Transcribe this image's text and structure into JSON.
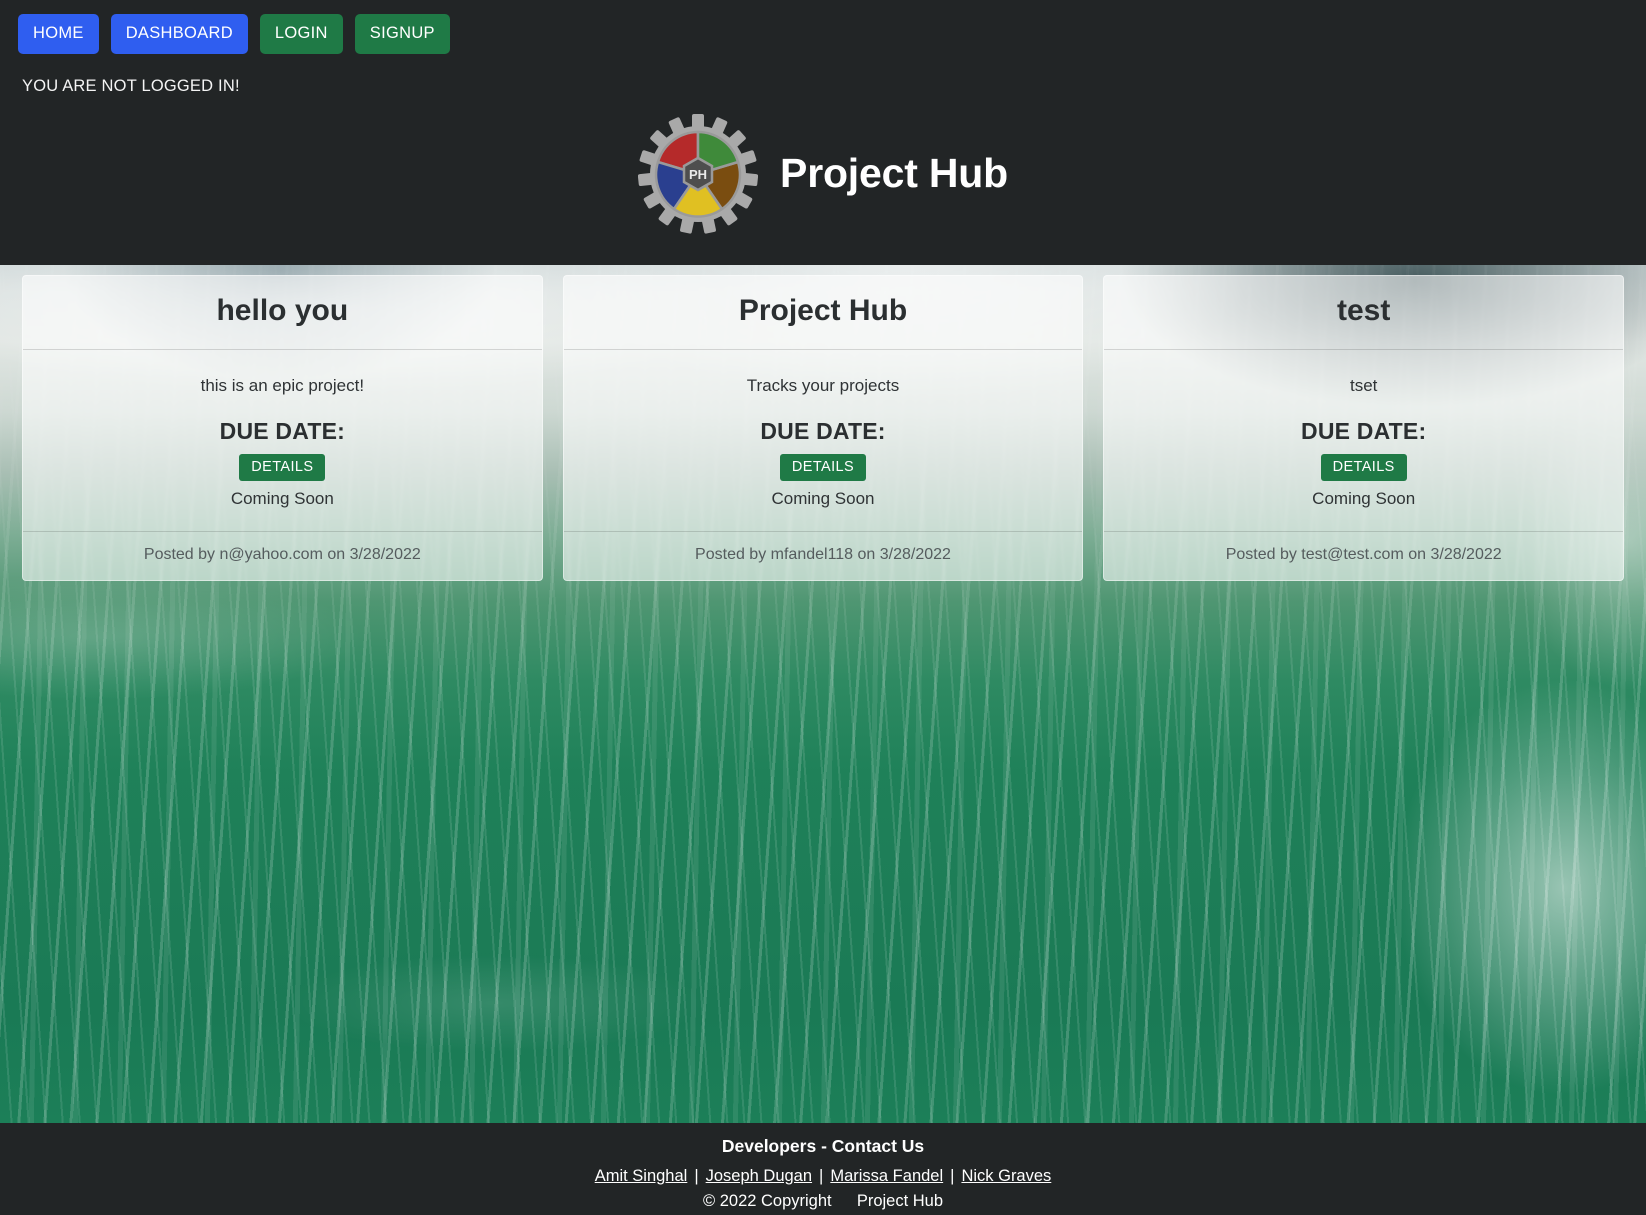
{
  "nav": {
    "buttons": [
      {
        "label": "HOME",
        "style": "blue",
        "name": "nav-home-button"
      },
      {
        "label": "DASHBOARD",
        "style": "blue",
        "name": "nav-dashboard-button"
      },
      {
        "label": "LOGIN",
        "style": "green",
        "name": "nav-login-button"
      },
      {
        "label": "SIGNUP",
        "style": "green",
        "name": "nav-signup-button"
      }
    ],
    "login_status": "YOU ARE NOT LOGGED IN!"
  },
  "brand": {
    "title": "Project Hub",
    "logo_icon": "gear-logo-icon",
    "logo_center_text": "PH",
    "logo_colors": {
      "gear": "#a8a8a8",
      "segment_red": "#b52a2a",
      "segment_green": "#3f8a3a",
      "segment_brown": "#7a4d10",
      "segment_yellow": "#e0c022",
      "segment_blue": "#2a3f8f",
      "center": "#4a4a4a"
    }
  },
  "colors": {
    "header_bg": "#222526",
    "nav_blue": "#2f5ef0",
    "nav_green": "#1f7a46",
    "details_green": "#1f7a46",
    "card_bg": "rgba(255,255,255,.58)",
    "ocean_green": "#1f8159"
  },
  "projects": [
    {
      "title": "hello you",
      "description": "this is an epic project!",
      "due_label": "DUE DATE:",
      "details_label": "DETAILS",
      "coming_soon": "Coming Soon",
      "posted": "Posted by n@yahoo.com on 3/28/2022"
    },
    {
      "title": "Project Hub",
      "description": "Tracks your projects",
      "due_label": "DUE DATE:",
      "details_label": "DETAILS",
      "coming_soon": "Coming Soon",
      "posted": "Posted by mfandel118 on 3/28/2022"
    },
    {
      "title": "test",
      "description": "tset",
      "due_label": "DUE DATE:",
      "details_label": "DETAILS",
      "coming_soon": "Coming Soon",
      "posted": "Posted by test@test.com on 3/28/2022"
    }
  ],
  "footer": {
    "title": "Developers - Contact Us",
    "links": [
      "Amit Singhal",
      "Joseph Dugan",
      "Marissa Fandel",
      "Nick Graves"
    ],
    "separator": "|",
    "copyright": "© 2022 Copyright",
    "copyright_site": "Project Hub"
  }
}
